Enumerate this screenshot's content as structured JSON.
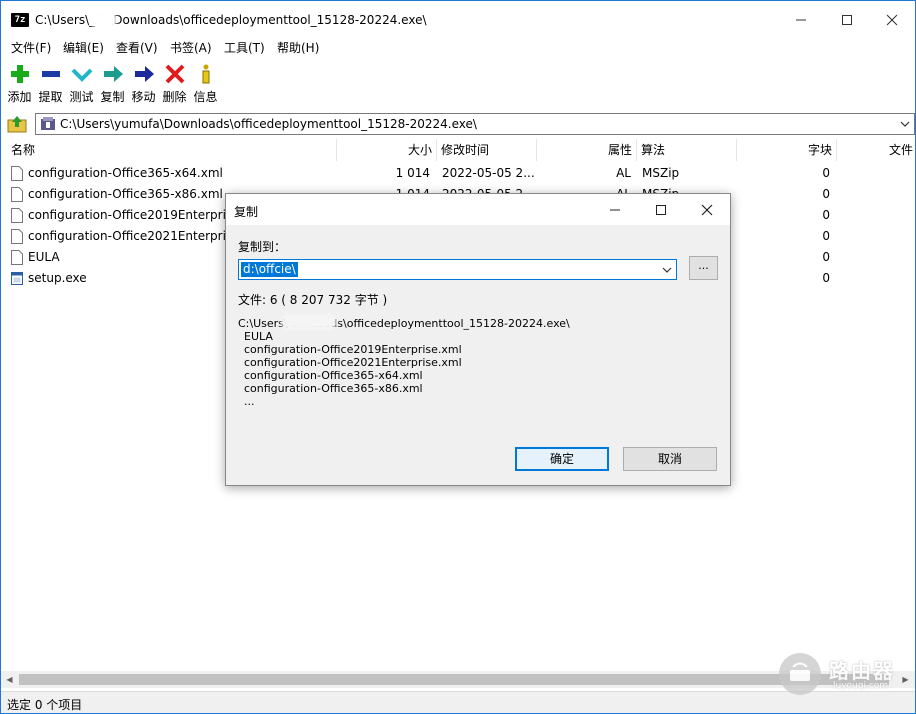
{
  "window": {
    "app_icon_text": "7z",
    "title": "C:\\Users\\_      ˘-\\Downloads\\officedeploymenttool_15128-20224.exe\\"
  },
  "menu": [
    "文件(F)",
    "编辑(E)",
    "查看(V)",
    "书签(A)",
    "工具(T)",
    "帮助(H)"
  ],
  "toolbar": [
    {
      "label": "添加",
      "icon": "add-icon"
    },
    {
      "label": "提取",
      "icon": "extract-icon"
    },
    {
      "label": "测试",
      "icon": "test-icon"
    },
    {
      "label": "复制",
      "icon": "copy-icon"
    },
    {
      "label": "移动",
      "icon": "move-icon"
    },
    {
      "label": "删除",
      "icon": "delete-icon"
    },
    {
      "label": "信息",
      "icon": "info-icon"
    }
  ],
  "address": {
    "path": "C:\\Users\\yumufa\\Downloads\\officedeploymenttool_15128-20224.exe\\"
  },
  "columns": {
    "name": "名称",
    "size": "大小",
    "modified": "修改时间",
    "attributes": "属性",
    "method": "算法",
    "block": "字块",
    "folder": "文件"
  },
  "files": [
    {
      "name": "configuration-Office365-x64.xml",
      "size": "1 014",
      "modified": "2022-05-05 2...",
      "attributes": "AL",
      "method": "MSZip",
      "block": "0",
      "icon": "file-icon"
    },
    {
      "name": "configuration-Office365-x86.xml",
      "size": "1 014",
      "modified": "2022-05-05 2...",
      "attributes": "AL",
      "method": "MSZip",
      "block": "0",
      "icon": "file-icon"
    },
    {
      "name": "configuration-Office2019Enterprise",
      "size": "",
      "modified": "",
      "attributes": "",
      "method": "",
      "block": "0",
      "icon": "file-icon"
    },
    {
      "name": "configuration-Office2021Enterprise",
      "size": "",
      "modified": "",
      "attributes": "",
      "method": "",
      "block": "0",
      "icon": "file-icon"
    },
    {
      "name": "EULA",
      "size": "",
      "modified": "",
      "attributes": "",
      "method": "",
      "block": "0",
      "icon": "file-icon"
    },
    {
      "name": "setup.exe",
      "size": "",
      "modified": "",
      "attributes": "",
      "method": "",
      "block": "0",
      "icon": "exe-icon"
    }
  ],
  "status": "选定 0 个项目",
  "dialog": {
    "title": "复制",
    "copy_to_label": "复制到：",
    "destination": "d:\\offcie\\",
    "browse_label": "...",
    "file_summary": "文件: 6   ( 8 207 732 字节 )",
    "source_path": "C:\\Users\\           ownloads\\officedeploymenttool_15128-20224.exe\\",
    "items": [
      "EULA",
      "configuration-Office2019Enterprise.xml",
      "configuration-Office2021Enterprise.xml",
      "configuration-Office365-x64.xml",
      "configuration-Office365-x86.xml",
      "..."
    ],
    "ok_label": "确定",
    "cancel_label": "取消"
  },
  "watermark": {
    "title": "路由器",
    "subtitle": "luyouqi.com"
  }
}
